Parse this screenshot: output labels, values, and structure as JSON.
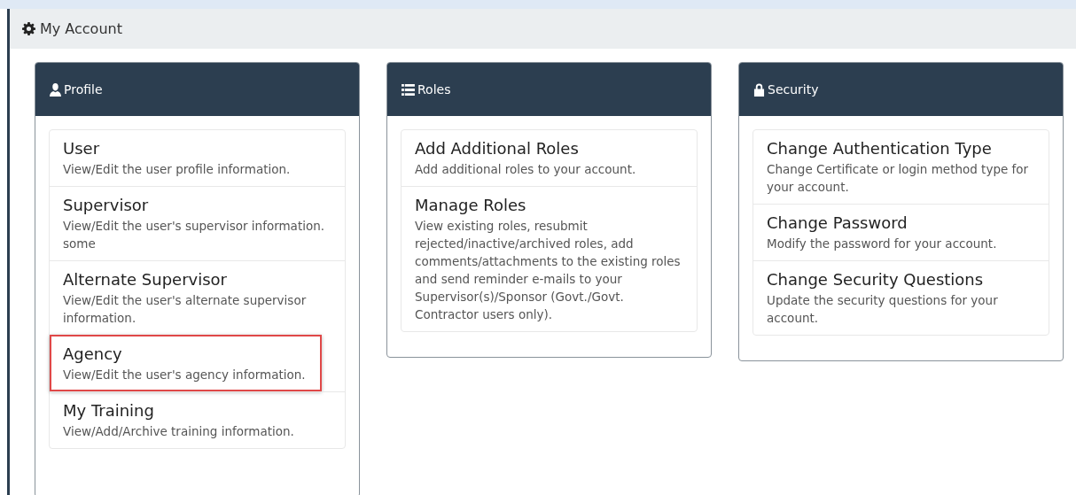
{
  "page_title": "My Account",
  "cards": [
    {
      "title": "Profile",
      "items": [
        {
          "title": "User",
          "description": "View/Edit the user profile information.",
          "highlighted": false
        },
        {
          "title": "Supervisor",
          "description": "View/Edit the user's supervisor information. some",
          "highlighted": false
        },
        {
          "title": "Alternate Supervisor",
          "description": "View/Edit the user's alternate supervisor information.",
          "highlighted": false
        },
        {
          "title": "Agency",
          "description": "View/Edit the user's agency information.",
          "highlighted": true
        },
        {
          "title": "My Training",
          "description": "View/Add/Archive training information.",
          "highlighted": false
        }
      ]
    },
    {
      "title": "Roles",
      "items": [
        {
          "title": "Add Additional Roles",
          "description": "Add additional roles to your account.",
          "highlighted": false
        },
        {
          "title": "Manage Roles",
          "description": "View existing roles, resubmit rejected/inactive/archived roles, add comments/attachments to the existing roles and send reminder e-mails to your Supervisor(s)/Sponsor (Govt./Govt. Contractor users only).",
          "highlighted": false
        }
      ]
    },
    {
      "title": "Security",
      "items": [
        {
          "title": "Change Authentication Type",
          "description": "Change Certificate or login method type for your account.",
          "highlighted": false
        },
        {
          "title": "Change Password",
          "description": "Modify the password for your account.",
          "highlighted": false
        },
        {
          "title": "Change Security Questions",
          "description": "Update the security questions for your account.",
          "highlighted": false
        }
      ]
    }
  ]
}
